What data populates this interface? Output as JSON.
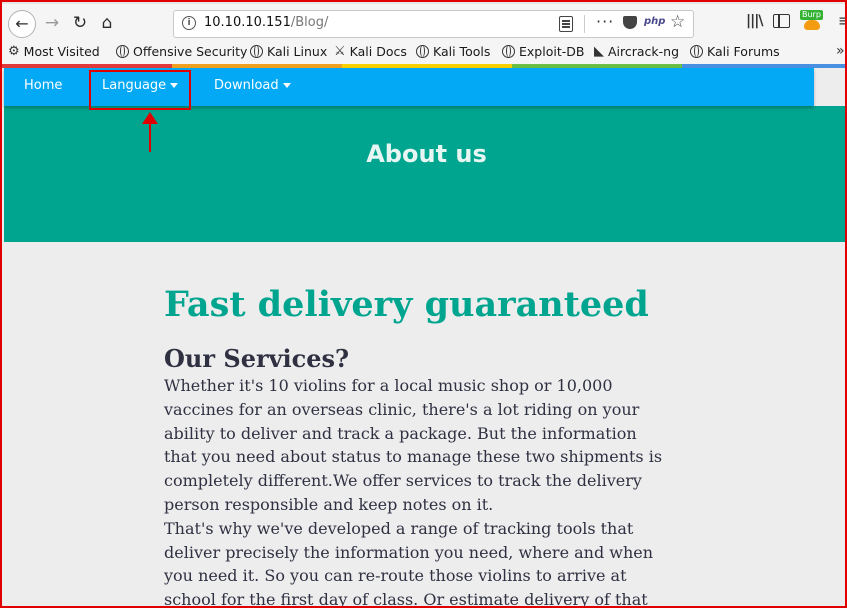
{
  "browser": {
    "url_host": "10.10.10.151",
    "url_path": "/Blog/",
    "icons": [
      "back-arrow-icon",
      "forward-arrow-icon",
      "reload-icon",
      "home-icon",
      "info-icon",
      "reader-view-icon",
      "more-actions-icon",
      "pocket-icon",
      "php-extension-icon",
      "bookmark-star-icon",
      "library-icon",
      "sidebar-icon",
      "burp-extension-icon",
      "hamburger-menu-icon"
    ],
    "burp_badge": "Burp",
    "nav_glyphs": {
      "back": "←",
      "forward": "→",
      "reload": "↻",
      "home": "⌂",
      "star": "☆",
      "menu": "≡",
      "dots": "···",
      "overflow": "»"
    }
  },
  "bookmarks": [
    {
      "label": "Most Visited",
      "icon": "gear-icon"
    },
    {
      "label": "Offensive Security",
      "icon": "globe-icon"
    },
    {
      "label": "Kali Linux",
      "icon": "globe-icon"
    },
    {
      "label": "Kali Docs",
      "icon": "kali-dragon-icon"
    },
    {
      "label": "Kali Tools",
      "icon": "globe-icon"
    },
    {
      "label": "Exploit-DB",
      "icon": "globe-icon"
    },
    {
      "label": "Aircrack-ng",
      "icon": "aircrack-icon"
    },
    {
      "label": "Kali Forums",
      "icon": "globe-icon"
    }
  ],
  "colorbar": [
    "#e23a3a",
    "#f0a020",
    "#f6d000",
    "#6abf45",
    "#4a90e2"
  ],
  "navbar": {
    "home": "Home",
    "language": "Language",
    "download": "Download"
  },
  "hero": {
    "title": "About us"
  },
  "content": {
    "headline": "Fast delivery guaranteed",
    "subhead": "Our Services?",
    "lines": [
      "Whether it's 10 violins for a local music shop or 10,000",
      "vaccines for an overseas clinic, there's a lot riding on your",
      "ability to deliver and track a package. But the information",
      "that you need about status to manage these two shipments is",
      "completely different.We offer services to track the delivery",
      "person responsible and keep notes on it.",
      "That's why we've developed a range of tracking tools that",
      "deliver precisely the information you need, where and when",
      "you need it. So you can re-route those violins to arrive at",
      "school for the first day of class. Or estimate delivery of that"
    ]
  },
  "colors": {
    "navbar": "#03a9f4",
    "hero": "#00a58f",
    "headline": "#00a58f",
    "body_text": "#2f3142",
    "annotation": "#e00000"
  }
}
